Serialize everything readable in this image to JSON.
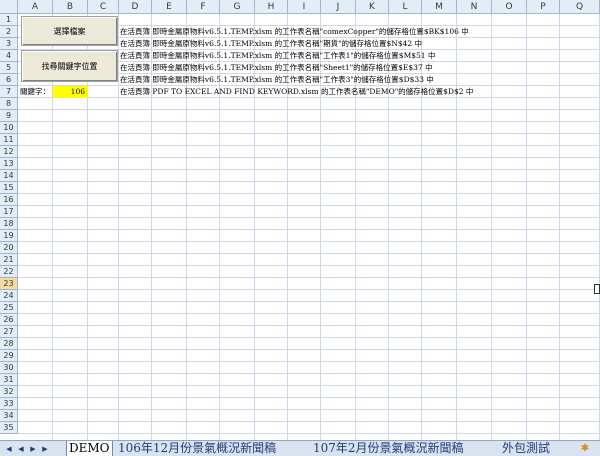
{
  "columns": [
    "A",
    "B",
    "C",
    "D",
    "E",
    "F",
    "G",
    "H",
    "I",
    "J",
    "K",
    "L",
    "M",
    "N",
    "O",
    "P",
    "Q"
  ],
  "rows": [
    "1",
    "2",
    "3",
    "4",
    "5",
    "6",
    "7",
    "8",
    "9",
    "10",
    "11",
    "12",
    "13",
    "14",
    "15",
    "16",
    "17",
    "18",
    "19",
    "20",
    "21",
    "22",
    "23",
    "24",
    "25",
    "26",
    "27",
    "28",
    "29",
    "30",
    "31",
    "32",
    "33",
    "34",
    "35"
  ],
  "active_row": "23",
  "buttons": {
    "select_file": "選擇檔案",
    "find_keyword": "找尋關鍵字位置"
  },
  "results": [
    "在活頁簿 即時金屬原物料v6.5.1.TEMP.xlsm 的工作表名稱\"comexCopper\"的儲存格位置$BK$106 中",
    "在活頁簿 即時金屬原物料v6.5.1.TEMP.xlsm 的工作表名稱\"期貨\"的儲存格位置$N$42 中",
    "在活頁簿 即時金屬原物料v6.5.1.TEMP.xlsm 的工作表名稱\"工作表1\"的儲存格位置$M$51 中",
    "在活頁簿 即時金屬原物料v6.5.1.TEMP.xlsm 的工作表名稱\"Sheet1\"的儲存格位置$E$37 中",
    "在活頁簿 即時金屬原物料v6.5.1.TEMP.xlsm 的工作表名稱\"工作表3\"的儲存格位置$D$33 中",
    "在活頁簿 PDF TO EXCEL AND FIND KEYWORD.xlsm 的工作表名稱\"DEMO\"的儲存格位置$D$2 中"
  ],
  "keyword_label": "關鍵字：",
  "keyword_value": "106",
  "sheet_tabs": [
    "DEMO",
    "106年12月份景氣概況新聞稿",
    "107年2月份景氣概況新聞稿",
    "外包測試"
  ],
  "active_tab": "DEMO",
  "colors": {
    "header_bg": "#e4ecf7",
    "grid": "#d0d7e5",
    "keyword_fill": "#ffff00",
    "active_row": "#f9d99f"
  }
}
